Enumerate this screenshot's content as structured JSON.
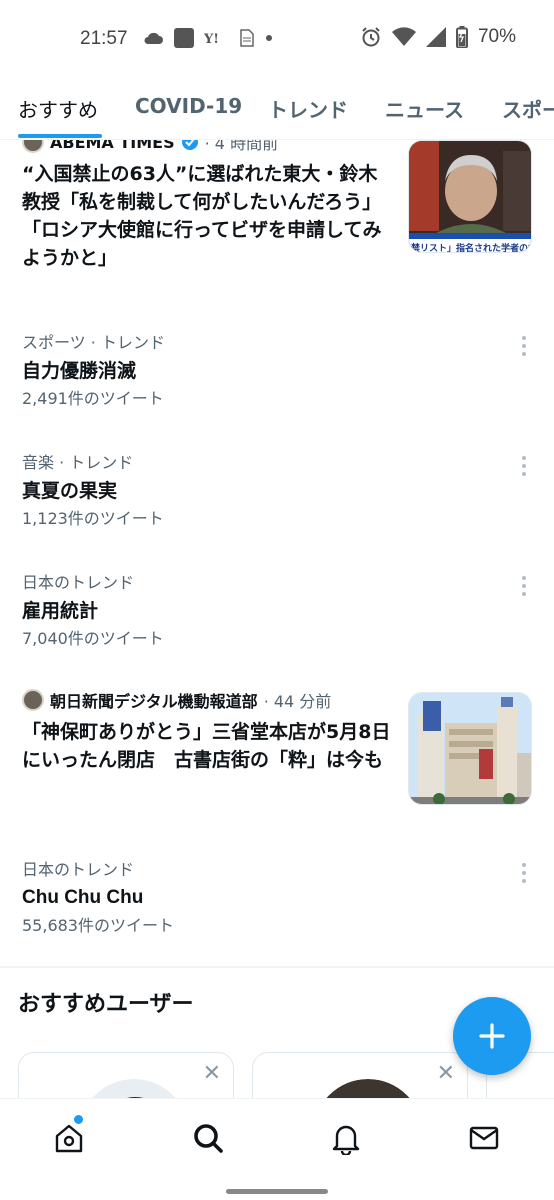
{
  "status_bar": {
    "time": "21:57",
    "battery": "70%",
    "icons_left": [
      "cloud-icon",
      "app-square-icon",
      "yahoo-icon",
      "document-icon",
      "dot-icon"
    ],
    "icons_right": [
      "alarm-icon",
      "wifi-icon",
      "signal-icon",
      "battery-icon"
    ]
  },
  "tabs": [
    {
      "label": "おすすめ",
      "active": true
    },
    {
      "label": "COVID-19",
      "active": false
    },
    {
      "label": "トレンド",
      "active": false
    },
    {
      "label": "ニュース",
      "active": false
    },
    {
      "label": "スポーツ",
      "active": false
    }
  ],
  "news": [
    {
      "source": "ABEMA TIMES",
      "verified": true,
      "time": "· 4 時間前",
      "text": "“入国禁止の63人”に選ばれた東大・鈴木教授「私を制裁して何がしたいんだろう」「ロシア大使館に行ってビザを申請してみようかと」",
      "thumb_caption": "禁リスト」指名された学者の本"
    },
    {
      "source": "朝日新聞デジタル機動報道部",
      "verified": false,
      "time": "· 44 分前",
      "text": "「神保町ありがとう」三省堂本店が5月8日にいったん閉店　古書店街の「粋」は今も"
    }
  ],
  "trends": [
    {
      "context": "スポーツ · トレンド",
      "name": "自力優勝消滅",
      "count": "2,491件のツイート"
    },
    {
      "context": "音楽 · トレンド",
      "name": "真夏の果実",
      "count": "1,123件のツイート"
    },
    {
      "context": "日本のトレンド",
      "name": "雇用統計",
      "count": "7,040件のツイート"
    },
    {
      "context": "日本のトレンド",
      "name": "Chu Chu Chu",
      "count": "55,683件のツイート"
    }
  ],
  "section": {
    "title": "おすすめユーザー"
  },
  "cards": [
    {
      "close": "✕"
    },
    {
      "close": "✕"
    }
  ],
  "fab": {
    "label": "+"
  },
  "bottom_nav": [
    "home-icon",
    "search-icon",
    "notifications-icon",
    "messages-icon"
  ],
  "colors": {
    "accent": "#1d9bf0",
    "text_primary": "#0f1419",
    "text_secondary": "#536471"
  }
}
